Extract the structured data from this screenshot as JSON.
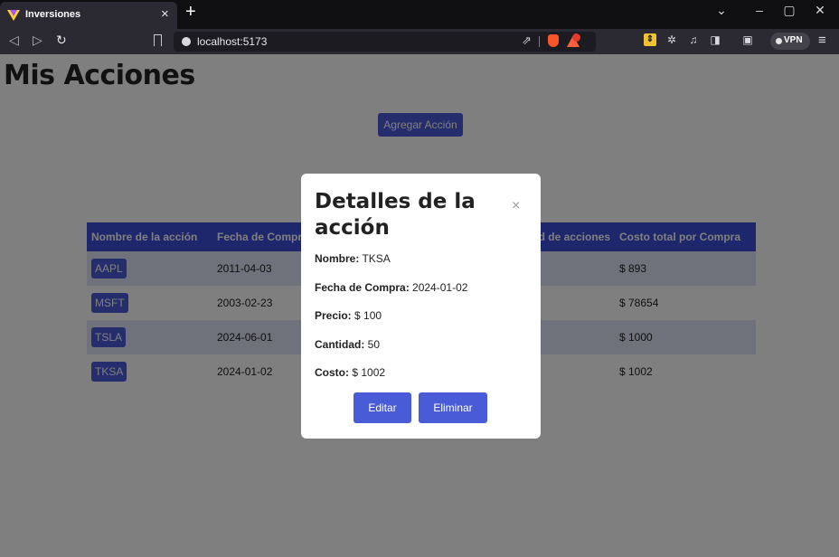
{
  "browser": {
    "tab_title": "Inversiones",
    "url": "localhost:5173",
    "vpn_label": "VPN"
  },
  "page": {
    "title": "Mis Acciones",
    "add_button": "Agregar Acción"
  },
  "table": {
    "headers": [
      "Nombre de la acción",
      "Fecha de Compra",
      "",
      "Cantidad de acciones",
      "Costo total por Compra"
    ],
    "rows": [
      {
        "name": "AAPL",
        "date": "2011-04-03",
        "cost": "$ 893"
      },
      {
        "name": "MSFT",
        "date": "2003-02-23",
        "cost": "$ 78654"
      },
      {
        "name": "TSLA",
        "date": "2024-06-01",
        "cost": "$ 1000"
      },
      {
        "name": "TKSA",
        "date": "2024-01-02",
        "cost": "$ 1002"
      }
    ]
  },
  "modal": {
    "title": "Detalles de la acción",
    "close": "×",
    "fields": [
      {
        "label": "Nombre:",
        "value": " TKSA"
      },
      {
        "label": "Fecha de Compra:",
        "value": " 2024-01-02"
      },
      {
        "label": "Precio:",
        "value": " $ 100"
      },
      {
        "label": "Cantidad:",
        "value": " 50"
      },
      {
        "label": "Costo:",
        "value": " $ 1002"
      }
    ],
    "edit_button": "Editar",
    "delete_button": "Eliminar"
  }
}
